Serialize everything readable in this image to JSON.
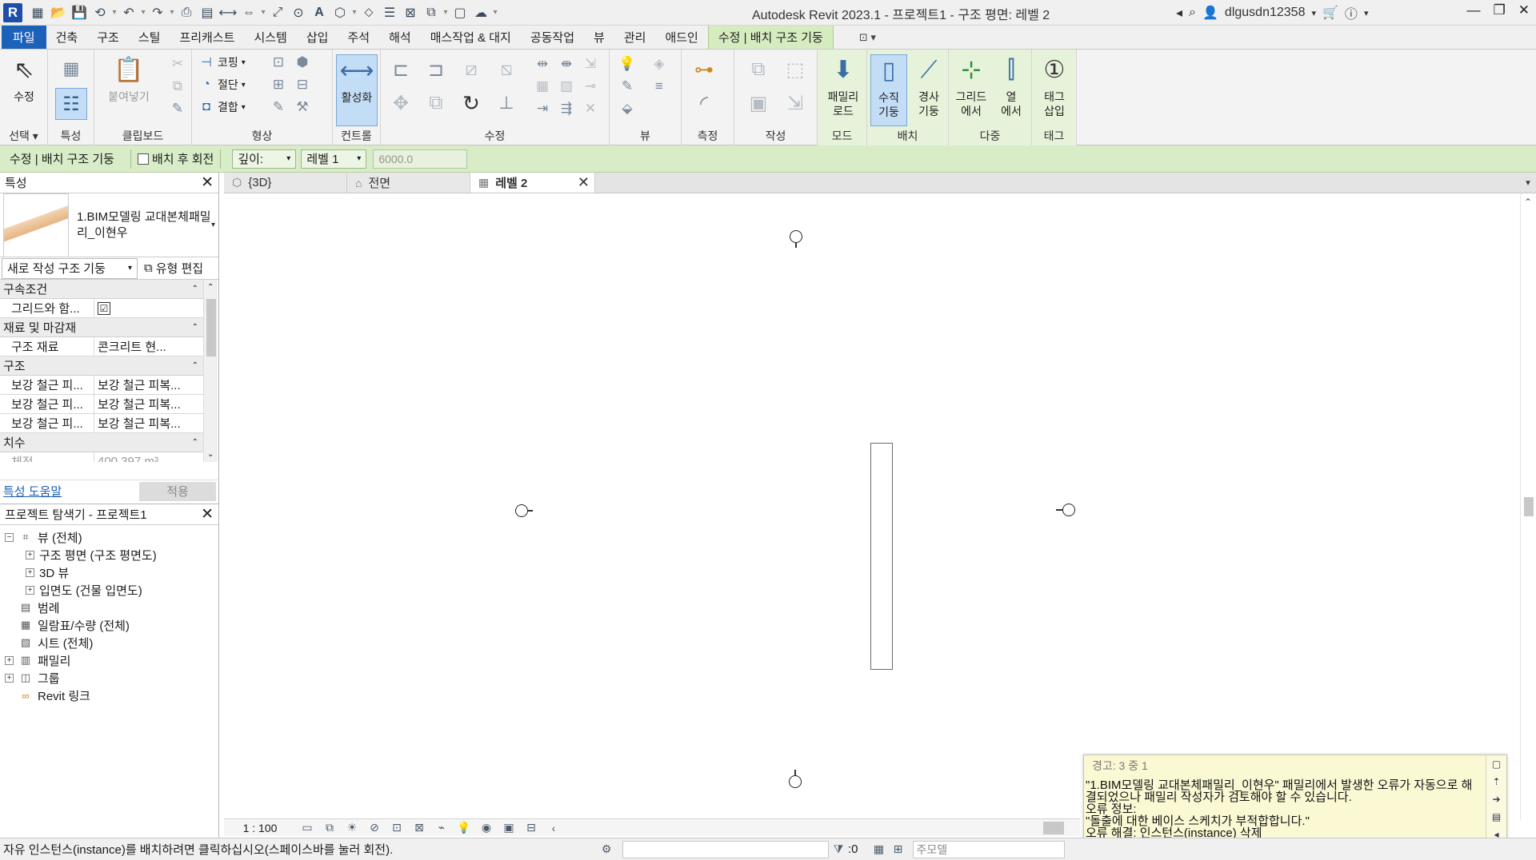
{
  "window": {
    "title": "Autodesk Revit 2023.1 - 프로젝트1 - 구조 평면: 레벨 2",
    "user": "dlgusdn12358"
  },
  "ribbon_tabs": [
    "파일",
    "건축",
    "구조",
    "스틸",
    "프리캐스트",
    "시스템",
    "삽입",
    "주석",
    "해석",
    "매스작업 & 대지",
    "공동작업",
    "뷰",
    "관리",
    "애드인",
    "수정 | 배치 구조 기둥"
  ],
  "ribbon": {
    "select": {
      "modify": "수정",
      "group_label": "선택"
    },
    "properties": {
      "group_label": "특성"
    },
    "clipboard": {
      "paste": "붙여넣기",
      "group_label": "클립보드"
    },
    "geometry": {
      "cope": "코핑",
      "cut": "절단",
      "join": "결합",
      "group_label": "형상"
    },
    "controls": {
      "activate": "활성화",
      "group_label": "컨트롤"
    },
    "modify": {
      "group_label": "수정"
    },
    "view": {
      "group_label": "뷰"
    },
    "measure": {
      "group_label": "측정"
    },
    "create": {
      "group_label": "작성"
    },
    "mode": {
      "load_family_1": "패밀리",
      "load_family_2": "로드",
      "group_label": "모드"
    },
    "placement": {
      "vertical_1": "수직",
      "vertical_2": "기둥",
      "slanted_1": "경사",
      "slanted_2": "기둥",
      "group_label": "배치"
    },
    "multiple": {
      "at_grids_1": "그리드",
      "at_grids_2": "에서",
      "at_columns_1": "열",
      "at_columns_2": "에서",
      "group_label": "다중"
    },
    "tag": {
      "tag_1": "태그",
      "tag_2": "삽입",
      "group_label": "태그"
    }
  },
  "options_bar": {
    "context": "수정 | 배치 구조 기둥",
    "rotate_after": "배치 후 회전",
    "depth_label": "깊이:",
    "level": "레벨 1",
    "height_value": "6000.0"
  },
  "properties": {
    "title": "특성",
    "type_name": "1.BIM모델링 교대본체패밀리_이현우",
    "new_label": "새로 작성 구조 기둥",
    "edit_type": "유형 편집",
    "categories": [
      {
        "name": "구속조건",
        "rows": [
          {
            "k": "그리드와 함...",
            "v": "☑"
          }
        ]
      },
      {
        "name": "재료 및 마감재",
        "rows": [
          {
            "k": "구조 재료",
            "v": "콘크리트 현..."
          }
        ]
      },
      {
        "name": "구조",
        "rows": [
          {
            "k": "보강 철근 피...",
            "v": "보강 철근 피복..."
          },
          {
            "k": "보강 철근 피...",
            "v": "보강 철근 피복..."
          },
          {
            "k": "보강 철근 피...",
            "v": "보강 철근 피복..."
          }
        ]
      },
      {
        "name": "치수",
        "rows": [
          {
            "k": "체적",
            "v": "400.397 m³"
          }
        ]
      }
    ],
    "help_link": "특성 도움말",
    "apply": "적용"
  },
  "browser": {
    "title": "프로젝트 탐색기 - 프로젝트1",
    "items": [
      {
        "label": "뷰 (전체)",
        "expand": "⊟",
        "icon": "views-icon",
        "level": 0
      },
      {
        "label": "구조 평면 (구조 평면도)",
        "expand": "⊞",
        "icon": "",
        "level": 1
      },
      {
        "label": "3D 뷰",
        "expand": "⊞",
        "icon": "",
        "level": 1
      },
      {
        "label": "입면도 (건물 입면도)",
        "expand": "⊞",
        "icon": "",
        "level": 1
      },
      {
        "label": "범례",
        "expand": "",
        "icon": "legend-icon",
        "level": 0
      },
      {
        "label": "일람표/수량 (전체)",
        "expand": "",
        "icon": "schedule-icon",
        "level": 0
      },
      {
        "label": "시트 (전체)",
        "expand": "",
        "icon": "sheet-icon",
        "level": 0
      },
      {
        "label": "패밀리",
        "expand": "⊞",
        "icon": "family-icon",
        "level": 0
      },
      {
        "label": "그룹",
        "expand": "⊞",
        "icon": "group-icon",
        "level": 0
      },
      {
        "label": "Revit 링크",
        "expand": "",
        "icon": "link-icon",
        "level": 0
      }
    ]
  },
  "view_tabs": [
    {
      "label": "{3D}",
      "icon": "3d-view-icon"
    },
    {
      "label": "전면",
      "icon": "elevation-icon"
    },
    {
      "label": "레벨 2",
      "icon": "plan-view-icon",
      "active": true
    }
  ],
  "view_control": {
    "scale": "1 : 100"
  },
  "warning": {
    "header": "경고: 3 중 1",
    "line1": "\"1.BIM모델링 교대본체패밀리_이현우\" 패밀리에서 발생한 오류가 자동으로 해",
    "line2": "결되었으나 패밀리 작성자가 검토해야 할 수 있습니다.",
    "line3": "오류 정보:",
    "line4": "\"돌출에 대한 베이스 스케치가 부적합합니다.\"",
    "line5": "오류 해결: 인스턴스(instance) 삭제"
  },
  "status": {
    "prompt": "자유 인스턴스(instance)를 배치하려면 클릭하십시오(스페이스바를 눌러 회전).",
    "count": ":0",
    "model": "주모델"
  }
}
